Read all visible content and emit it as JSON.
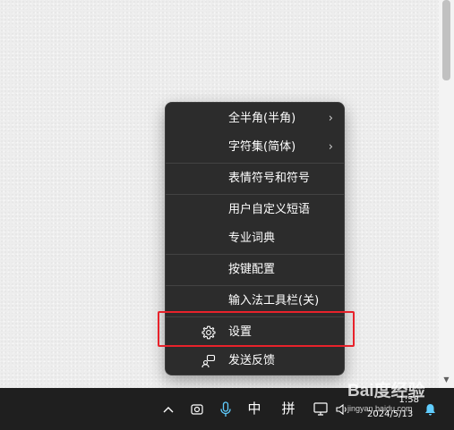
{
  "menu": {
    "items": [
      {
        "label": "全半角(半角)",
        "submenu": true
      },
      {
        "label": "字符集(简体)",
        "submenu": true
      },
      {
        "label": "表情符号和符号",
        "submenu": false
      },
      {
        "label": "用户自定义短语",
        "submenu": false
      },
      {
        "label": "专业词典",
        "submenu": false
      },
      {
        "label": "按键配置",
        "submenu": false
      },
      {
        "label": "输入法工具栏(关)",
        "submenu": false
      },
      {
        "label": "设置",
        "submenu": false,
        "icon": "gear-icon",
        "highlighted": true
      },
      {
        "label": "发送反馈",
        "submenu": false,
        "icon": "feedback-icon"
      }
    ],
    "chevron": "›",
    "highlight_color": "#e8222b"
  },
  "taskbar": {
    "chevron_up": "^",
    "ime_mode": "中",
    "ime_layout": "拼",
    "clock_time": "1:58",
    "clock_date": "2024/5/13",
    "mic_color": "#60cdff",
    "bell_color": "#60cdff"
  },
  "watermark": {
    "brand": "Bai度经验",
    "sub": "jingyan.baidu.com"
  },
  "scrollbar": {
    "down_arrow": "▼"
  }
}
